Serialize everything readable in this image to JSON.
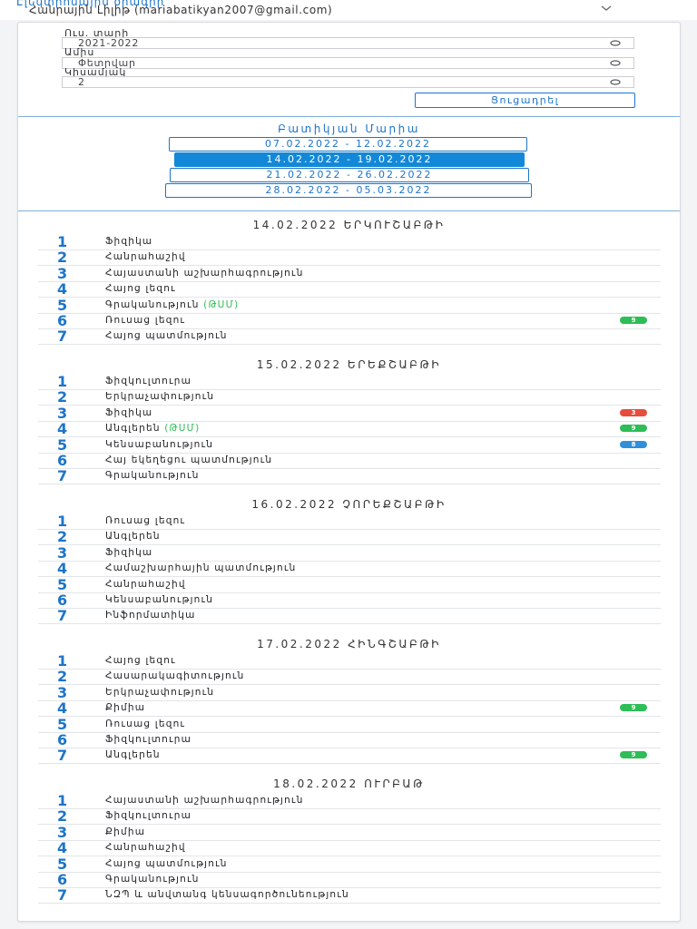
{
  "header": {
    "title": "Էլեկտրոնային օրագիր",
    "user": "Հանրային Լիլիթ (mariabatikyan2007@gmail.com)"
  },
  "filters": {
    "year_label": "Ուս. տարի",
    "year_value": "2021-2022",
    "month_label": "Ամիս",
    "month_value": "Փետրվար",
    "semester_label": "Կիսամյակ",
    "semester_value": "2",
    "show_button": "Ցուցադրել"
  },
  "student_name": "Բատիկյան Մարիա",
  "weeks": [
    {
      "label": "07.02.2022 - 12.02.2022",
      "active": false
    },
    {
      "label": "14.02.2022 - 19.02.2022",
      "active": true
    },
    {
      "label": "21.02.2022 - 26.02.2022",
      "active": false
    },
    {
      "label": "28.02.2022 - 05.03.2022",
      "active": false
    }
  ],
  "colors": {
    "accent": "#1d74c9",
    "active_week": "#1388d8",
    "grade_green": "#2ebd56",
    "grade_red": "#e74c3c",
    "grade_blue": "#2f8fd9"
  },
  "days": [
    {
      "header": "14.02.2022 ԵՐԿՈՒՇԱԲԹԻ",
      "lessons": [
        {
          "num": "1",
          "subject": "Ֆիզիկա"
        },
        {
          "num": "2",
          "subject": "Հանրահաշիվ"
        },
        {
          "num": "3",
          "subject": "Հայաստանի աշխարհագրություն"
        },
        {
          "num": "4",
          "subject": "Հայոց լեզու"
        },
        {
          "num": "5",
          "subject": "Գրականություն",
          "note": "(ԹՍՄ)"
        },
        {
          "num": "6",
          "subject": "Ռուսաց լեզու",
          "grade": "9",
          "grade_color": "green"
        },
        {
          "num": "7",
          "subject": "Հայոց պատմություն"
        }
      ]
    },
    {
      "header": "15.02.2022 ԵՐԵՔՇԱԲԹԻ",
      "lessons": [
        {
          "num": "1",
          "subject": "Ֆիզկուլտուրա"
        },
        {
          "num": "2",
          "subject": "Երկրաչափություն"
        },
        {
          "num": "3",
          "subject": "Ֆիզիկա",
          "grade": "3",
          "grade_color": "red"
        },
        {
          "num": "4",
          "subject": "Անգլերեն",
          "note": "(ԹՍՄ)",
          "grade": "9",
          "grade_color": "green"
        },
        {
          "num": "5",
          "subject": "Կենսաբանություն",
          "grade": "8",
          "grade_color": "blue"
        },
        {
          "num": "6",
          "subject": "Հայ եկեղեցու պատմություն"
        },
        {
          "num": "7",
          "subject": "Գրականություն"
        }
      ]
    },
    {
      "header": "16.02.2022 ՉՈՐԵՔՇԱԲԹԻ",
      "lessons": [
        {
          "num": "1",
          "subject": "Ռուսաց լեզու"
        },
        {
          "num": "2",
          "subject": "Անգլերեն"
        },
        {
          "num": "3",
          "subject": "Ֆիզիկա"
        },
        {
          "num": "4",
          "subject": "Համաշխարհային պատմություն"
        },
        {
          "num": "5",
          "subject": "Հանրահաշիվ"
        },
        {
          "num": "6",
          "subject": "Կենսաբանություն"
        },
        {
          "num": "7",
          "subject": "Ինֆորմատիկա"
        }
      ]
    },
    {
      "header": "17.02.2022 ՀԻՆԳՇԱԲԹԻ",
      "lessons": [
        {
          "num": "1",
          "subject": "Հայոց լեզու"
        },
        {
          "num": "2",
          "subject": "Հասարակագիտություն"
        },
        {
          "num": "3",
          "subject": "Երկրաչափություն"
        },
        {
          "num": "4",
          "subject": "Քիմիա",
          "grade": "9",
          "grade_color": "green"
        },
        {
          "num": "5",
          "subject": "Ռուսաց լեզու"
        },
        {
          "num": "6",
          "subject": "Ֆիզկուլտուրա"
        },
        {
          "num": "7",
          "subject": "Անգլերեն",
          "grade": "9",
          "grade_color": "green"
        }
      ]
    },
    {
      "header": "18.02.2022 ՈՒՐԲԱԹ",
      "lessons": [
        {
          "num": "1",
          "subject": "Հայաստանի աշխարհագրություն"
        },
        {
          "num": "2",
          "subject": "Ֆիզկուլտուրա"
        },
        {
          "num": "3",
          "subject": "Քիմիա"
        },
        {
          "num": "4",
          "subject": "Հանրահաշիվ"
        },
        {
          "num": "5",
          "subject": "Հայոց պատմություն"
        },
        {
          "num": "6",
          "subject": "Գրականություն"
        },
        {
          "num": "7",
          "subject": "ՆԶՊ և անվտանգ կենսագործունեություն"
        }
      ]
    }
  ]
}
